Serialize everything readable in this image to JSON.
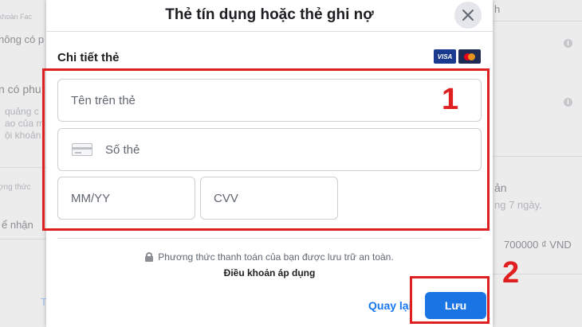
{
  "background": {
    "left_texts": [
      "khoản Fac",
      "hông có p",
      "n có phu",
      "quảng c",
      "ao của m",
      "ội khoản",
      "ợng thức",
      "ể nhận"
    ],
    "right_texts": [
      "h",
      "ản",
      "ng 7 ngày.",
      "700000 ₫ VND",
      "T"
    ]
  },
  "modal": {
    "title": "Thẻ tín dụng hoặc thẻ ghi nợ",
    "section_title": "Chi tiết thẻ",
    "card_brands": [
      "VISA",
      "Mastercard"
    ],
    "fields": {
      "name_placeholder": "Tên trên thẻ",
      "number_placeholder": "Số thẻ",
      "expiry_placeholder": "MM/YY",
      "cvv_placeholder": "CVV"
    },
    "secure_note": "Phương thức thanh toán của bạn được lưu trữ an toàn.",
    "terms_link": "Điều khoản áp dụng",
    "back_label": "Quay lại",
    "save_label": "Lưu"
  },
  "annotations": {
    "step1": "1",
    "step2": "2",
    "color": "#e02020"
  },
  "colors": {
    "primary": "#1b74e4",
    "link": "#1877f2"
  }
}
